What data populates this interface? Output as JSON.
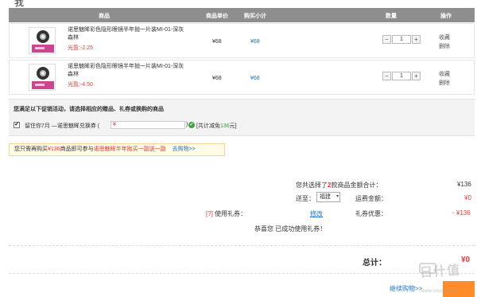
{
  "header": {
    "top_cut": "我(我)",
    "col_product": "商品",
    "col_unit_price": "商品单价",
    "col_subtotal": "购买小计",
    "col_quantity": "数量",
    "col_ops": "操作"
  },
  "items": [
    {
      "name": "诺思魅眸彩色隐形眼镜半年抛一片装MI-01-深灰森林",
      "promo": "光盈:-2.25",
      "unit_price": "¥68",
      "subtotal": "¥68",
      "qty": "1",
      "minus": "−",
      "plus": "+",
      "fav": "收藏",
      "del": "删除"
    },
    {
      "name": "诺思魅眸彩色隐形眼镜半年抛一片装MI-01-深灰森林",
      "promo": "光盈:-4.50",
      "unit_price": "¥68",
      "subtotal": "¥68",
      "qty": "1",
      "minus": "−",
      "plus": "+",
      "fav": "收藏",
      "del": "删除"
    }
  ],
  "promotion": {
    "title": "您满足以下促销活动，请选择相应的赠品、礼券或换购的商品",
    "checkbox": "✔",
    "gift_text": "留住你7月 —诺思魅眸兑换券 (",
    "gift_value": "¥",
    "gift_close": ")",
    "ok": "✔",
    "total_prefix": "[共计减免",
    "total_amount": "136",
    "total_suffix": "元]"
  },
  "tip": {
    "prefix": "您只需再购买",
    "amount": "¥136",
    "middle": "商品即可参与",
    "event": "诺思魅眸半年抛买一副送一副",
    "link": "去购物>>"
  },
  "summary": {
    "selected_prefix": "您共选择了",
    "selected_count": "2",
    "selected_suffix": "款商品金额合计：",
    "goods_total": "¥136",
    "ship_label": "送至：",
    "ship_value": "福建",
    "ship_arrow": "▾",
    "freight_label": "运费金额：",
    "freight_value": "¥0",
    "coupon_q": "[?]",
    "coupon_label": "使用礼券：",
    "coupon_modify": "修改",
    "discount_label": "礼券优惠：",
    "discount_value": "- ¥136",
    "success": "恭喜您 已成功使用礼券！"
  },
  "footer": {
    "total_label": "总计：",
    "total_value": "¥0",
    "continue_label": "继续购物>>"
  },
  "watermark": {
    "text": "日什值",
    "url": "www.smzdm.com"
  }
}
